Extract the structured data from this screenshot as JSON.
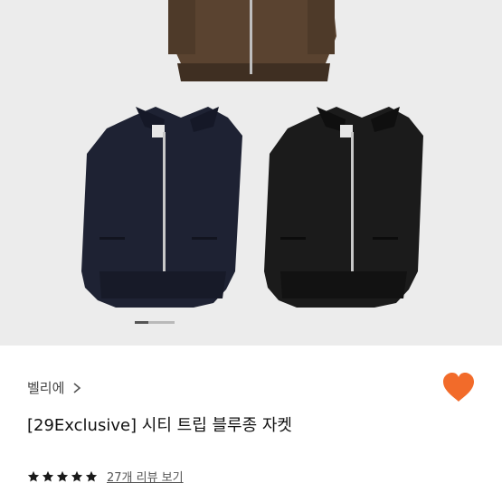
{
  "product": {
    "brand": "벨리에",
    "title": "[29Exclusive] 시티 트립 블루종 자켓",
    "rating_stars": 5,
    "review_link": "27개 리뷰 보기"
  },
  "gallery": {
    "current_index": 1,
    "progress": 0.33,
    "items": [
      {
        "label": "brown-jacket",
        "color": "#5a4330"
      },
      {
        "label": "navy-jacket",
        "color": "#1e2233"
      },
      {
        "label": "black-jacket",
        "color": "#1b1b1b"
      }
    ]
  },
  "colors": {
    "accent_heart": "#f26b2a",
    "star": "#1a1a1a",
    "gallery_bg": "#ececec"
  },
  "icons": {
    "brand_chevron": "chevron-right-icon",
    "wishlist": "heart-icon",
    "rating": "star-icon"
  }
}
